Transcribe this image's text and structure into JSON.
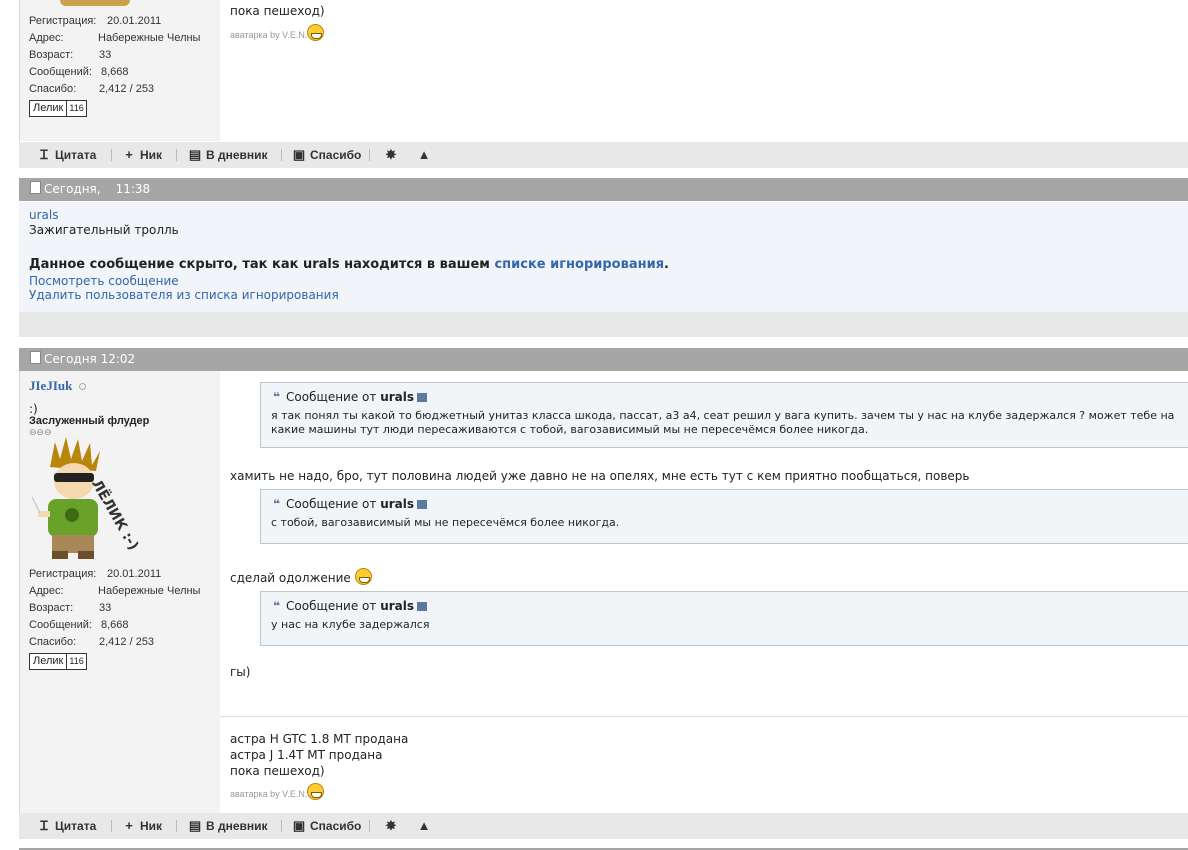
{
  "post1": {
    "partial_text_top": "пока пешеход)",
    "avatar_credit": "аватарка by V.E.N.",
    "user_info": [
      {
        "label": "Регистрация:",
        "value": "20.01.2011"
      },
      {
        "label": "Адрес:",
        "value": "Набережные Челны"
      },
      {
        "label": "Возраст:",
        "value": "33"
      },
      {
        "label": "Сообщений:",
        "value": "8,668"
      },
      {
        "label": "Спасибо:",
        "value": "2,412 / 253"
      }
    ],
    "badge": {
      "name": "Лелик",
      "count": "116"
    }
  },
  "toolbar": {
    "quote": "Цитата",
    "nick": "Ник",
    "diary": "В дневник",
    "thanks": "Спасибо"
  },
  "post2": {
    "date": "Сегодня,",
    "time": "11:38",
    "username": "urals",
    "user_title": "Зажигательный тролль",
    "hidden_msg": "Данное сообщение скрыто, так как urals находится в вашем",
    "ignore_link": "списке игнорирования",
    "ignore_end": ".",
    "view_link": "Посмотреть сообщение",
    "remove_link": "Удалить пользователя из списка игнорирования"
  },
  "post3": {
    "datetime": "Сегодня 12:02",
    "username": "JIeJIuk",
    "status": ":)",
    "user_title": "Заслуженный флудер",
    "rep": "⊖⊖⊖",
    "avatar_caption": "ЛЁЛИК :-)",
    "user_info": [
      {
        "label": "Регистрация:",
        "value": "20.01.2011"
      },
      {
        "label": "Адрес:",
        "value": "Набережные Челны"
      },
      {
        "label": "Возраст:",
        "value": "33"
      },
      {
        "label": "Сообщений:",
        "value": "8,668"
      },
      {
        "label": "Спасибо:",
        "value": "2,412 / 253"
      }
    ],
    "badge": {
      "name": "Лелик",
      "count": "116"
    },
    "quote_header_prefix": "Сообщение от",
    "quote_author": "urals",
    "quote1_line1": "я так понял ты какой то бюджетный унитаз класса шкода, пассат, а3 а4, сеат решил у вага купить. зачем ты у нас на клубе задержался ? может тебе на",
    "quote1_line2": "какие машины тут люди пересаживаются с тобой, вагозависимый мы не пересечёмся более никогда.",
    "reply1": "хамить не надо, бро, тут половина людей уже давно не на опелях, мне есть тут с кем приятно пообщаться, поверь",
    "quote2": "с тобой, вагозависимый мы не пересечёмся более никогда.",
    "reply2": "сделай одолжение",
    "quote3": "у нас на клубе задержался",
    "reply3": "гы)",
    "signature": [
      "астра H GTC 1.8 MT продана",
      "астра J 1.4T MT продана",
      "пока пешеход)"
    ],
    "avatar_credit": "аватарка by V.E.N."
  }
}
